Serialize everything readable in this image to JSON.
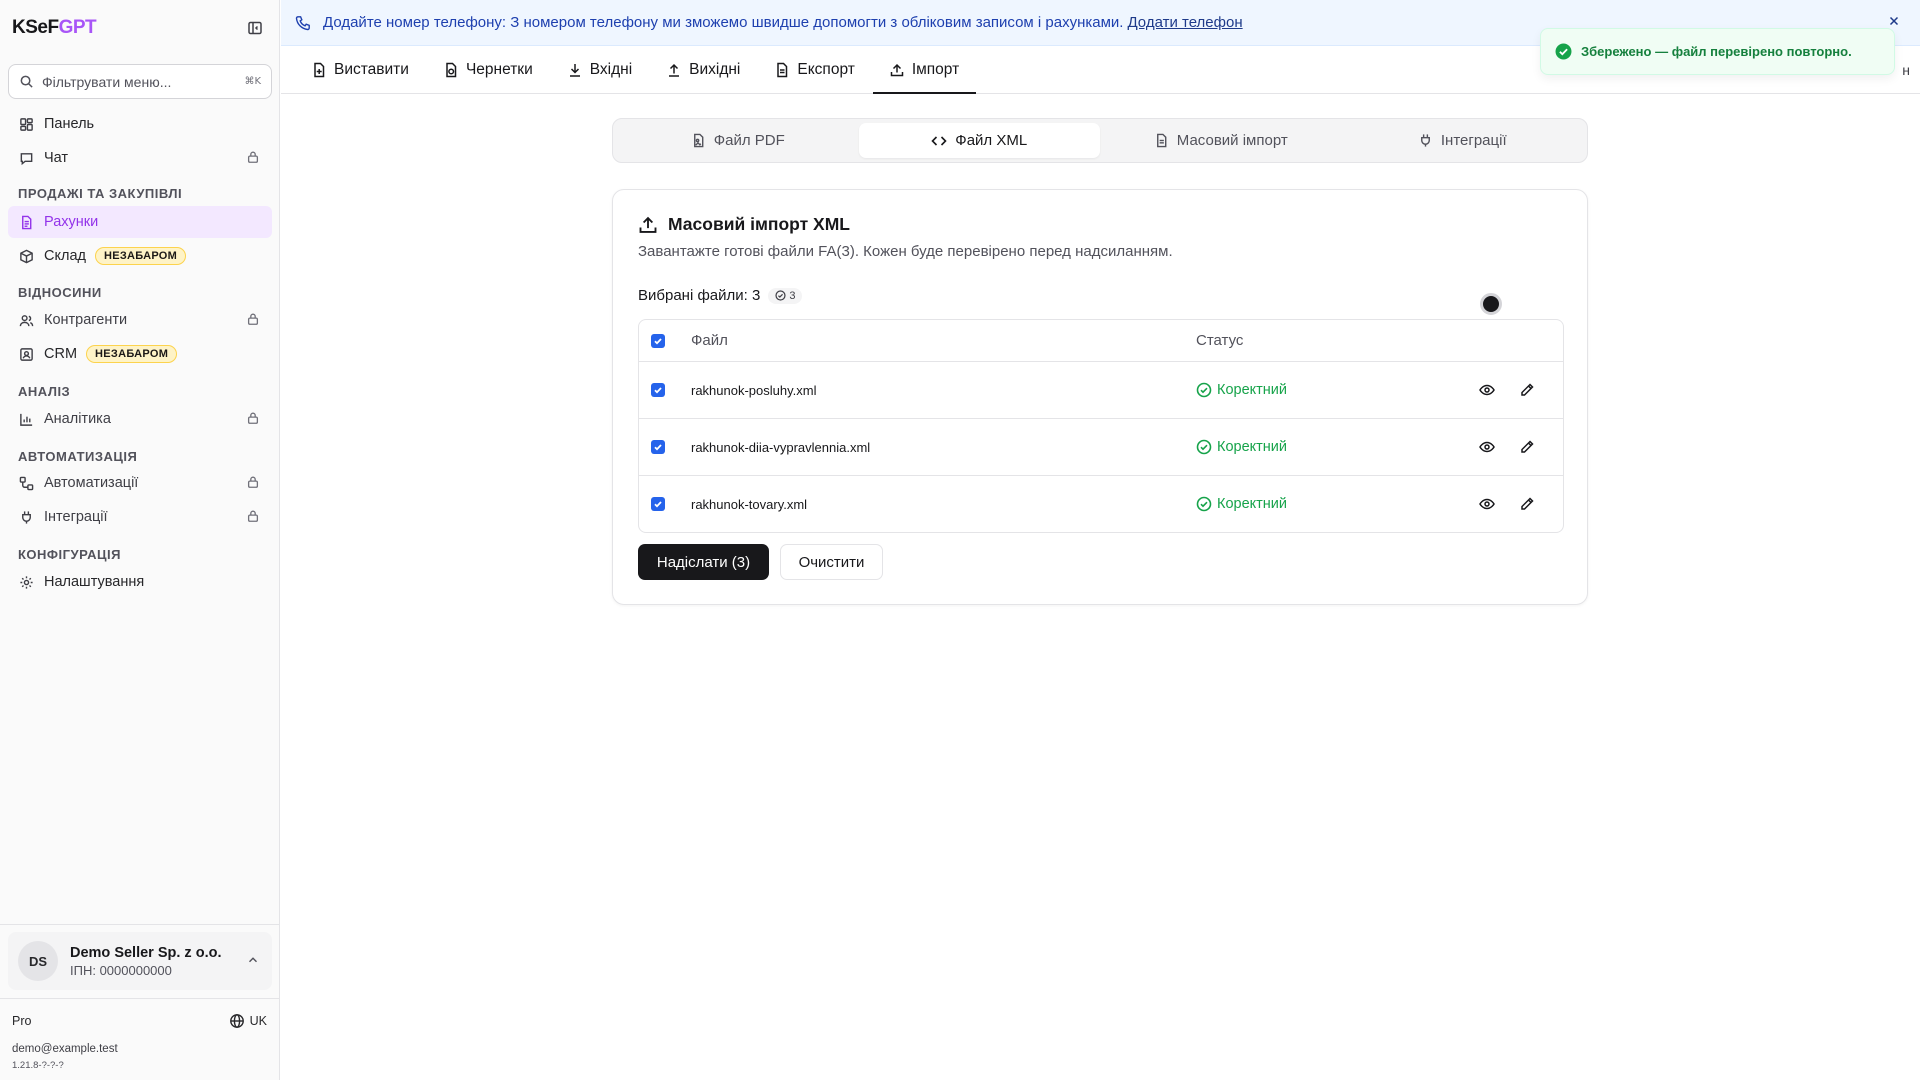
{
  "app": {
    "logo_part1": "KSeF",
    "logo_part2": "GPT"
  },
  "sidebar": {
    "search_placeholder": "Фільтрувати меню...",
    "search_shortcut": "⌘K",
    "items": {
      "panel": "Панель",
      "chat": "Чат",
      "invoices": "Рахунки",
      "warehouse": "Склад",
      "contractors": "Контрагенти",
      "crm": "CRM",
      "analytics": "Аналітика",
      "automations": "Автоматизації",
      "integrations": "Інтеграції",
      "settings": "Налаштування"
    },
    "sections": {
      "sales": "ПРОДАЖІ ТА ЗАКУПІВЛІ",
      "relations": "ВІДНОСИНИ",
      "analysis": "АНАЛІЗ",
      "automation": "АВТОМАТИЗАЦІЯ",
      "config": "КОНФІГУРАЦІЯ"
    },
    "badge_soon": "НЕЗАБАРОМ",
    "account": {
      "initials": "DS",
      "name": "Demo Seller Sp. z o.o.",
      "tax_id": "ІПН: 0000000000"
    },
    "plan": "Pro",
    "language": "UK",
    "email": "demo@example.test",
    "version": "1.21.8-?-?-?"
  },
  "banner": {
    "text": "Додайте номер телефону: З номером телефону ми зможемо швидше допомогти з обліковим записом і рахунками.",
    "link": "Додати телефон"
  },
  "topnav": {
    "tabs": [
      "Виставити",
      "Чернетки",
      "Вхідні",
      "Вихідні",
      "Експорт",
      "Імпорт"
    ],
    "truncated": "н"
  },
  "toast": {
    "text": "Збережено — файл перевірено повторно."
  },
  "subtabs": [
    "Файл PDF",
    "Файл XML",
    "Масовий імпорт",
    "Інтеграції"
  ],
  "card": {
    "title": "Масовий імпорт XML",
    "description": "Завантажте готові файли FA(3). Кожен буде перевірено перед надсиланням.",
    "selected_label": "Вибрані файли: 3",
    "selected_badge": "3",
    "columns": {
      "file": "Файл",
      "status": "Статус"
    },
    "rows": [
      {
        "file": "rakhunok-posluhy.xml",
        "status": "Коректний"
      },
      {
        "file": "rakhunok-diia-vypravlennia.xml",
        "status": "Коректний"
      },
      {
        "file": "rakhunok-tovary.xml",
        "status": "Коректний"
      }
    ],
    "submit_label": "Надіслати (3)",
    "clear_label": "Очистити"
  },
  "colors": {
    "accent": "#a855f7",
    "success": "#16a34a",
    "banner_text": "#1e40af",
    "checkbox": "#2563eb"
  }
}
